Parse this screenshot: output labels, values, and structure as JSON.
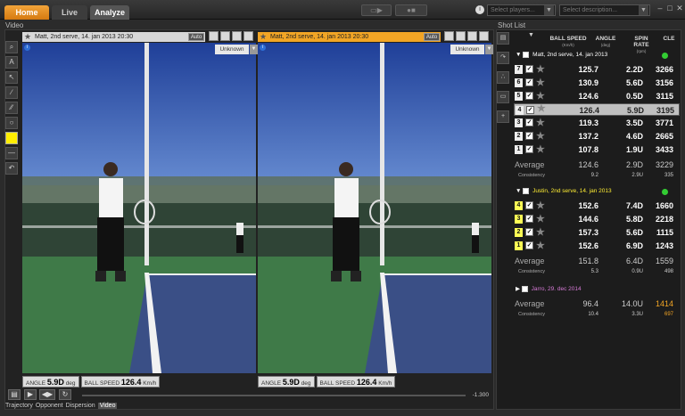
{
  "tabs": [
    {
      "label": "Home"
    },
    {
      "label": "Live"
    },
    {
      "label": "Analyze"
    }
  ],
  "filters": {
    "players_placeholder": "Select players...",
    "description_placeholder": "Select description..."
  },
  "video": {
    "section_label": "Video",
    "left": {
      "title": "Matt, 2nd serve, 14. jan 2013 20:30",
      "auto_label": "Auto",
      "result_label": "Unknown",
      "angle_label": "ANGLE",
      "angle_value": "5.9D",
      "angle_unit": "deg",
      "speed_label": "BALL SPEED",
      "speed_value": "126.4",
      "speed_unit": "Km/h"
    },
    "right": {
      "title": "Matt, 2nd serve, 14. jan 2013 20:30",
      "auto_label": "Auto",
      "result_label": "Unknown",
      "angle_label": "ANGLE",
      "angle_value": "5.9D",
      "angle_unit": "deg",
      "speed_label": "BALL SPEED",
      "speed_value": "126.4",
      "speed_unit": "Km/h"
    },
    "time": "-1.300"
  },
  "bottom_tabs": [
    "Trajectory",
    "Opponent",
    "Dispersion",
    "Video"
  ],
  "shot_list": {
    "section_label": "Shot List",
    "columns": [
      {
        "label": "BALL SPEED",
        "unit": "(Km/h)"
      },
      {
        "label": "ANGLE",
        "unit": "(deg)"
      },
      {
        "label": "SPIN RATE",
        "unit": "(rpm)"
      },
      {
        "label": "CLE",
        "unit": ""
      }
    ],
    "groups": [
      {
        "title": "Matt, 2nd serve, 14. jan 2013",
        "rows": [
          {
            "num": "7",
            "speed": "125.7",
            "angle": "2.2D",
            "spin": "3266"
          },
          {
            "num": "6",
            "speed": "130.9",
            "angle": "5.6D",
            "spin": "3156"
          },
          {
            "num": "5",
            "speed": "124.6",
            "angle": "0.5D",
            "spin": "3115"
          },
          {
            "num": "4",
            "speed": "126.4",
            "angle": "5.9D",
            "spin": "3195"
          },
          {
            "num": "3",
            "speed": "119.3",
            "angle": "3.5D",
            "spin": "3771"
          },
          {
            "num": "2",
            "speed": "137.2",
            "angle": "4.6D",
            "spin": "2665"
          },
          {
            "num": "1",
            "speed": "107.8",
            "angle": "1.9U",
            "spin": "3433"
          }
        ],
        "average_label": "Average",
        "avg_speed": "124.6",
        "avg_angle": "2.9D",
        "avg_spin": "3229",
        "consistency_label": "Consistency",
        "con_speed": "9.2",
        "con_angle": "2.9U",
        "con_spin": "335"
      },
      {
        "title": "Justin, 2nd serve, 14. jan 2013",
        "rows": [
          {
            "num": "4",
            "speed": "152.6",
            "angle": "7.4D",
            "spin": "1660"
          },
          {
            "num": "3",
            "speed": "144.6",
            "angle": "5.8D",
            "spin": "2218"
          },
          {
            "num": "2",
            "speed": "157.3",
            "angle": "5.6D",
            "spin": "1115"
          },
          {
            "num": "1",
            "speed": "152.6",
            "angle": "6.9D",
            "spin": "1243"
          }
        ],
        "average_label": "Average",
        "avg_speed": "151.8",
        "avg_angle": "6.4D",
        "avg_spin": "1559",
        "consistency_label": "Consistency",
        "con_speed": "5.3",
        "con_angle": "0.9U",
        "con_spin": "498"
      },
      {
        "title": "Jarro, 29. dec 2014",
        "average_label": "Average",
        "avg_speed": "96.4",
        "avg_angle": "14.0U",
        "avg_spin": "1414",
        "consistency_label": "Consistency",
        "con_speed": "10.4",
        "con_angle": "3.3U",
        "con_spin": "697"
      }
    ]
  }
}
